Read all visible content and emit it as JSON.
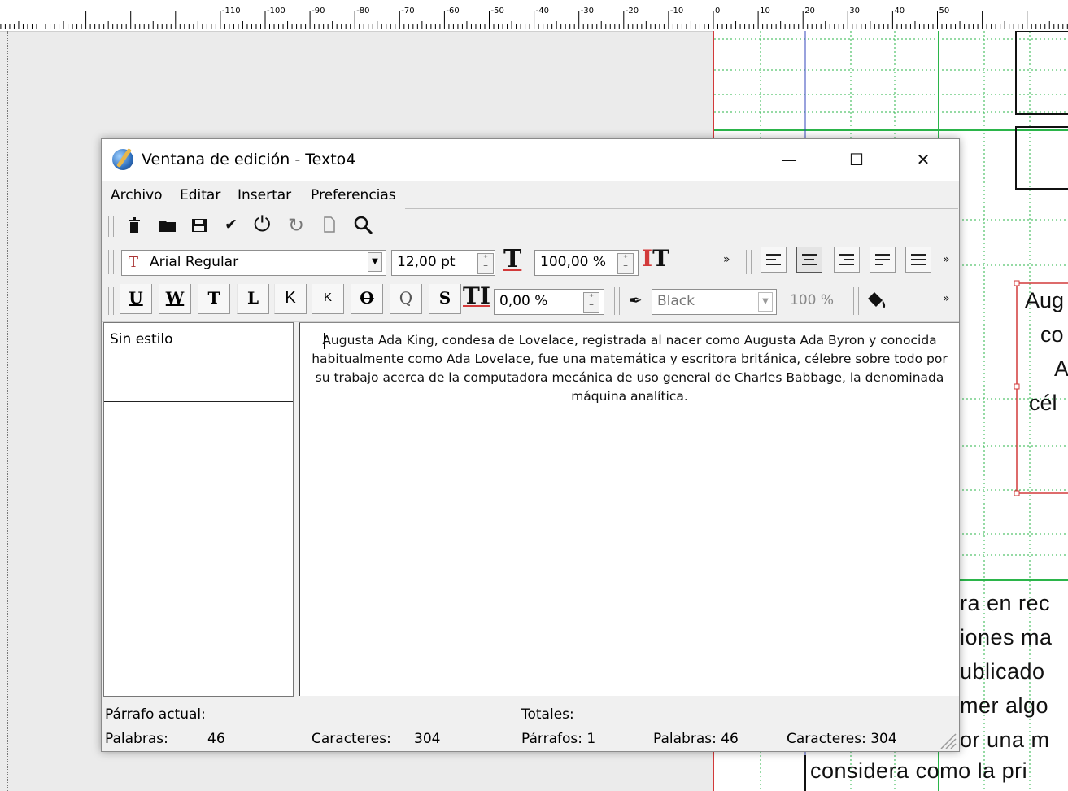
{
  "ruler": {
    "labels": [
      "-110",
      "-100",
      "-90",
      "-80",
      "-70",
      "-60",
      "-50",
      "-40",
      "-30",
      "-20",
      "-10",
      "0",
      "10",
      "20",
      "30",
      "40",
      "50"
    ]
  },
  "document": {
    "frame_lines": [
      "Aug",
      "co",
      "A",
      "cél"
    ],
    "body_lines": [
      "ra en rec",
      "iones ma",
      "ublicado",
      "mer algo",
      "or una m",
      "considera como la pri"
    ]
  },
  "window": {
    "title": "Ventana de edición - Texto4",
    "controls": {
      "minimize": "—",
      "maximize": "☐",
      "close": "✕"
    }
  },
  "menu": [
    "Archivo",
    "Editar",
    "Insertar",
    "Preferencias"
  ],
  "toolbar1": {
    "icons": [
      "trash-icon",
      "folder-icon",
      "save-icon",
      "check-icon",
      "power-icon",
      "redo-icon",
      "page-icon",
      "search-icon"
    ]
  },
  "toolbar2": {
    "font": "Arial Regular",
    "font_size": "12,00 pt",
    "scale": "100,00 %",
    "more": "»"
  },
  "toolbar3": {
    "tracking": "0,00 %",
    "color": "Black",
    "shade": "100 %",
    "more": "»",
    "buttons": [
      "U",
      "W",
      "T",
      "L",
      "K",
      "K",
      "O",
      "Q",
      "S",
      "TI"
    ]
  },
  "styles": {
    "item": "Sin estilo"
  },
  "editor": {
    "text": "Augusta Ada King, condesa de Lovelace, registrada al nacer como Augusta Ada Byron y conocida habitualmente como Ada Lovelace, fue una matemática y escritora británica, célebre sobre todo por su trabajo acerca de la computadora mecánica de uso general de Charles Babbage, la denominada máquina analítica."
  },
  "status": {
    "current_paragraph_label": "Párrafo actual:",
    "words_label": "Palabras:",
    "words_value": "46",
    "chars_label": "Caracteres:",
    "chars_value": "304",
    "totals_label": "Totales:",
    "total_paragraphs": "Párrafos: 1",
    "total_words": "Palabras: 46",
    "total_chars": "Caracteres: 304"
  }
}
